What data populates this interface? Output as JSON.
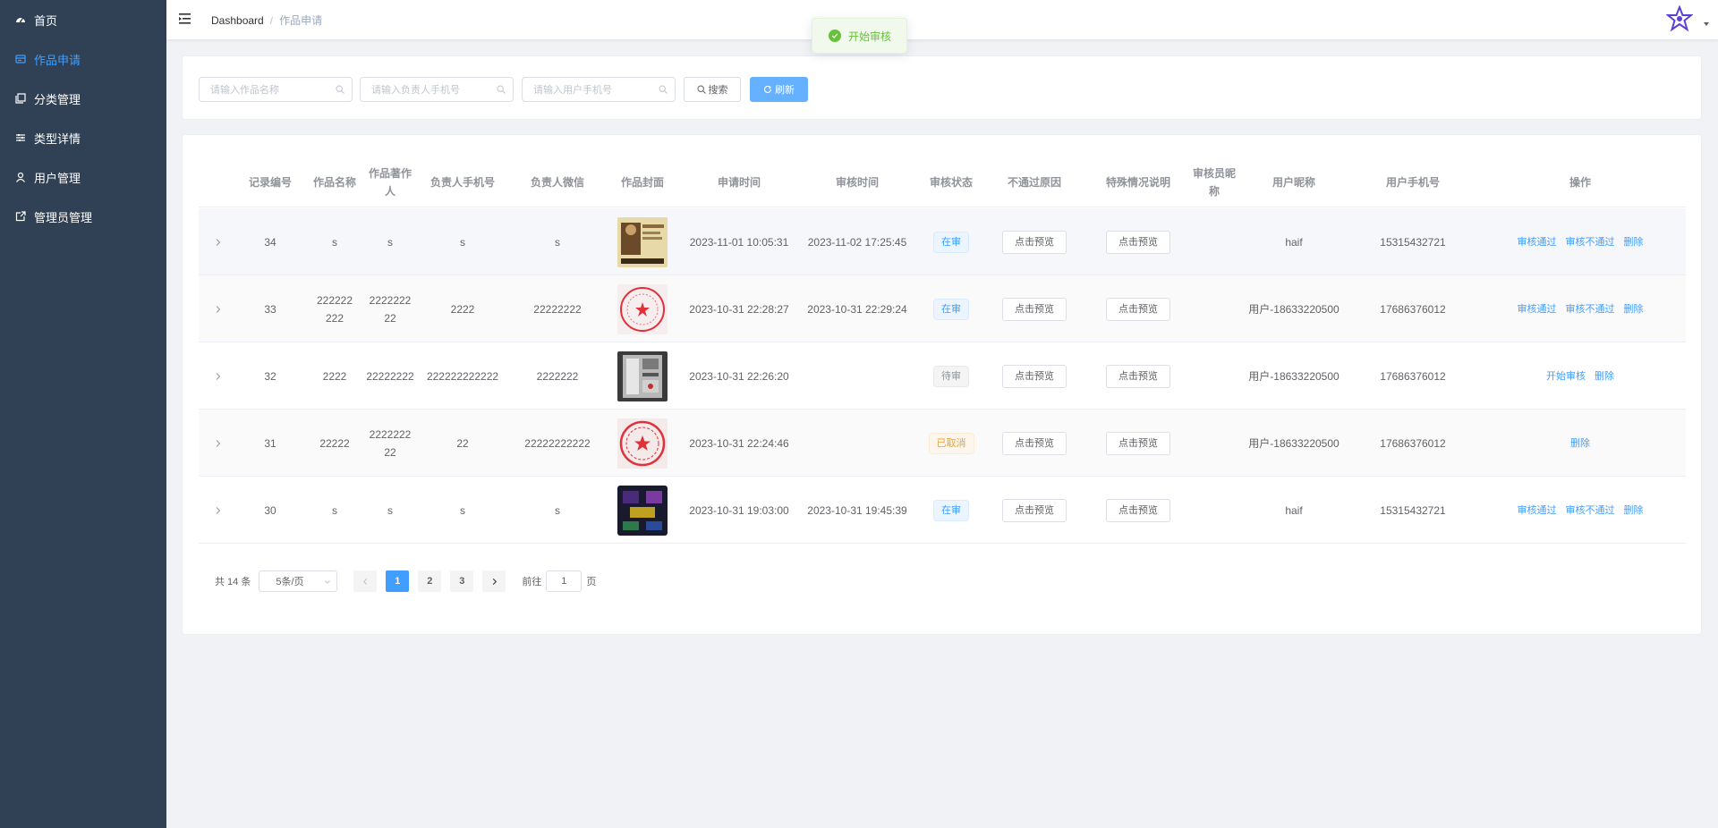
{
  "sidebar": {
    "items": [
      {
        "label": "首页",
        "icon": "dashboard-icon"
      },
      {
        "label": "作品申请",
        "icon": "form-icon",
        "active": true
      },
      {
        "label": "分类管理",
        "icon": "copy-icon"
      },
      {
        "label": "类型详情",
        "icon": "sliders-icon"
      },
      {
        "label": "用户管理",
        "icon": "user-icon"
      },
      {
        "label": "管理员管理",
        "icon": "external-link-icon"
      }
    ]
  },
  "header": {
    "breadcrumb_home": "Dashboard",
    "breadcrumb_sep": "/",
    "breadcrumb_current": "作品申请"
  },
  "toast": {
    "text": "开始审核"
  },
  "search": {
    "work_name_placeholder": "请输入作品名称",
    "owner_phone_placeholder": "请输入负责人手机号",
    "user_phone_placeholder": "请输入用户手机号",
    "search_label": "搜索",
    "refresh_label": "刷新"
  },
  "table": {
    "columns": [
      "记录编号",
      "作品名称",
      "作品著作人",
      "负责人手机号",
      "负责人微信",
      "作品封面",
      "申请时间",
      "审核时间",
      "审核状态",
      "不通过原因",
      "特殊情况说明",
      "审核员昵称",
      "用户昵称",
      "用户手机号",
      "操作"
    ],
    "preview_label": "点击预览",
    "rows": [
      {
        "id": "34",
        "name": "s",
        "author": "s",
        "owner_phone": "s",
        "owner_wechat": "s",
        "cover": "painting",
        "apply_time": "2023-11-01 10:05:31",
        "review_time": "2023-11-02 17:25:45",
        "status": "在审",
        "status_color": "blue",
        "reviewer": "",
        "nickname": "haif",
        "phone": "15315432721",
        "ops": [
          "审核通过",
          "审核不通过",
          "删除"
        ]
      },
      {
        "id": "33",
        "name": "222222222",
        "author": "222222222",
        "owner_phone": "2222",
        "owner_wechat": "22222222",
        "cover": "red-seal",
        "apply_time": "2023-10-31 22:28:27",
        "review_time": "2023-10-31 22:29:24",
        "status": "在审",
        "status_color": "blue",
        "reviewer": "",
        "nickname": "用户-18633220500",
        "phone": "17686376012",
        "ops": [
          "审核通过",
          "审核不通过",
          "删除"
        ]
      },
      {
        "id": "32",
        "name": "2222",
        "author": "22222222",
        "owner_phone": "222222222222",
        "owner_wechat": "2222222",
        "cover": "photo",
        "apply_time": "2023-10-31 22:26:20",
        "review_time": "",
        "status": "待审",
        "status_color": "gray",
        "reviewer": "",
        "nickname": "用户-18633220500",
        "phone": "17686376012",
        "ops": [
          "开始审核",
          "删除"
        ]
      },
      {
        "id": "31",
        "name": "22222",
        "author": "222222222",
        "owner_phone": "22",
        "owner_wechat": "22222222222",
        "cover": "red-seal-star",
        "apply_time": "2023-10-31 22:24:46",
        "review_time": "",
        "status": "已取消",
        "status_color": "orange",
        "reviewer": "",
        "nickname": "用户-18633220500",
        "phone": "17686376012",
        "ops": [
          "删除"
        ]
      },
      {
        "id": "30",
        "name": "s",
        "author": "s",
        "owner_phone": "s",
        "owner_wechat": "s",
        "cover": "game",
        "apply_time": "2023-10-31 19:03:00",
        "review_time": "2023-10-31 19:45:39",
        "status": "在审",
        "status_color": "blue",
        "reviewer": "",
        "nickname": "haif",
        "phone": "15315432721",
        "ops": [
          "审核通过",
          "审核不通过",
          "删除"
        ]
      }
    ]
  },
  "pagination": {
    "total_label": "共 14 条",
    "page_size": "5条/页",
    "pages": [
      "1",
      "2",
      "3"
    ],
    "current": "1",
    "goto_label": "前往",
    "goto_value": "1",
    "page_unit": "页"
  }
}
